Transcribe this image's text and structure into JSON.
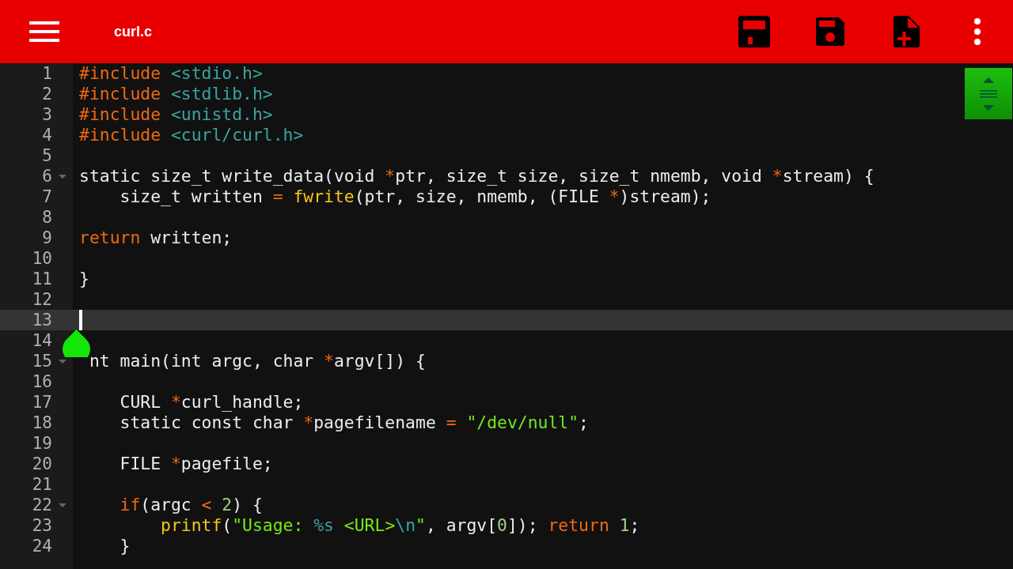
{
  "toolbar": {
    "title": "curl.c"
  },
  "lines": [
    {
      "number": "1",
      "fold": false,
      "selected": false,
      "tokens": [
        {
          "kind": "keyword",
          "text": "#include "
        },
        {
          "kind": "header",
          "text": "<stdio.h>"
        }
      ]
    },
    {
      "number": "2",
      "fold": false,
      "selected": false,
      "tokens": [
        {
          "kind": "keyword",
          "text": "#include "
        },
        {
          "kind": "header",
          "text": "<stdlib.h>"
        }
      ]
    },
    {
      "number": "3",
      "fold": false,
      "selected": false,
      "tokens": [
        {
          "kind": "keyword",
          "text": "#include "
        },
        {
          "kind": "header",
          "text": "<unistd.h>"
        }
      ]
    },
    {
      "number": "4",
      "fold": false,
      "selected": false,
      "tokens": [
        {
          "kind": "keyword",
          "text": "#include "
        },
        {
          "kind": "header",
          "text": "<curl/curl.h>"
        }
      ]
    },
    {
      "number": "5",
      "fold": false,
      "selected": false
    },
    {
      "number": "6",
      "fold": true,
      "selected": false,
      "tokens": [
        {
          "kind": "plain",
          "text": "static size_t write_data(void "
        },
        {
          "kind": "operator",
          "text": "*"
        },
        {
          "kind": "plain",
          "text": "ptr, size_t size, size_t nmemb, void "
        },
        {
          "kind": "operator",
          "text": "*"
        },
        {
          "kind": "plain",
          "text": "stream) {"
        }
      ]
    },
    {
      "number": "7",
      "fold": false,
      "selected": false,
      "tokens": [
        {
          "kind": "plain",
          "text": "    size_t written "
        },
        {
          "kind": "operator",
          "text": "= "
        },
        {
          "kind": "function",
          "text": "fwrite"
        },
        {
          "kind": "plain",
          "text": "(ptr, size, nmemb, (FILE "
        },
        {
          "kind": "operator",
          "text": "*"
        },
        {
          "kind": "plain",
          "text": ")stream);"
        }
      ]
    },
    {
      "number": "8",
      "fold": false,
      "selected": false
    },
    {
      "number": "9",
      "fold": false,
      "selected": false,
      "tokens": [
        {
          "kind": "keyword",
          "text": "return"
        },
        {
          "kind": "plain",
          "text": " written;"
        }
      ]
    },
    {
      "number": "10",
      "fold": false,
      "selected": false
    },
    {
      "number": "11",
      "fold": false,
      "selected": false,
      "tokens": [
        {
          "kind": "plain",
          "text": "}"
        }
      ]
    },
    {
      "number": "12",
      "fold": false,
      "selected": false
    },
    {
      "number": "13",
      "fold": false,
      "selected": true
    },
    {
      "number": "14",
      "fold": false,
      "selected": false
    },
    {
      "number": "15",
      "fold": true,
      "selected": false,
      "tokens": [
        {
          "kind": "plain",
          "text": "nt main(int argc, char "
        },
        {
          "kind": "operator",
          "text": "*"
        },
        {
          "kind": "plain",
          "text": "argv[]) {"
        }
      ]
    },
    {
      "number": "16",
      "fold": false,
      "selected": false
    },
    {
      "number": "17",
      "fold": false,
      "selected": false,
      "tokens": [
        {
          "kind": "plain",
          "text": "    CURL "
        },
        {
          "kind": "operator",
          "text": "*"
        },
        {
          "kind": "plain",
          "text": "curl_handle;"
        }
      ]
    },
    {
      "number": "18",
      "fold": false,
      "selected": false,
      "tokens": [
        {
          "kind": "plain",
          "text": "    static const char "
        },
        {
          "kind": "operator",
          "text": "*"
        },
        {
          "kind": "plain",
          "text": "pagefilename "
        },
        {
          "kind": "operator",
          "text": "= "
        },
        {
          "kind": "string",
          "text": "\"/dev/null\""
        },
        {
          "kind": "plain",
          "text": ";"
        }
      ]
    },
    {
      "number": "19",
      "fold": false,
      "selected": false
    },
    {
      "number": "20",
      "fold": false,
      "selected": false,
      "tokens": [
        {
          "kind": "plain",
          "text": "    FILE "
        },
        {
          "kind": "operator",
          "text": "*"
        },
        {
          "kind": "plain",
          "text": "pagefile;"
        }
      ]
    },
    {
      "number": "21",
      "fold": false,
      "selected": false
    },
    {
      "number": "22",
      "fold": true,
      "selected": false,
      "tokens": [
        {
          "kind": "keyword",
          "text": "    if"
        },
        {
          "kind": "plain",
          "text": "(argc "
        },
        {
          "kind": "operator",
          "text": "< "
        },
        {
          "kind": "number",
          "text": "2"
        },
        {
          "kind": "plain",
          "text": ") {"
        }
      ]
    },
    {
      "number": "23",
      "fold": false,
      "selected": false,
      "tokens": [
        {
          "kind": "function",
          "text": "        printf"
        },
        {
          "kind": "plain",
          "text": "("
        },
        {
          "kind": "string",
          "text": "\"Usage: "
        },
        {
          "kind": "escape",
          "text": "%s"
        },
        {
          "kind": "string",
          "text": " <URL>"
        },
        {
          "kind": "escape",
          "text": "\\n"
        },
        {
          "kind": "string",
          "text": "\""
        },
        {
          "kind": "plain",
          "text": ", argv["
        },
        {
          "kind": "number",
          "text": "0"
        },
        {
          "kind": "plain",
          "text": "]); "
        },
        {
          "kind": "keyword",
          "text": "return "
        },
        {
          "kind": "number",
          "text": "1"
        },
        {
          "kind": "plain",
          "text": ";"
        }
      ]
    },
    {
      "number": "24",
      "fold": false,
      "selected": false,
      "tokens": [
        {
          "kind": "plain",
          "text": "    }"
        }
      ]
    }
  ]
}
